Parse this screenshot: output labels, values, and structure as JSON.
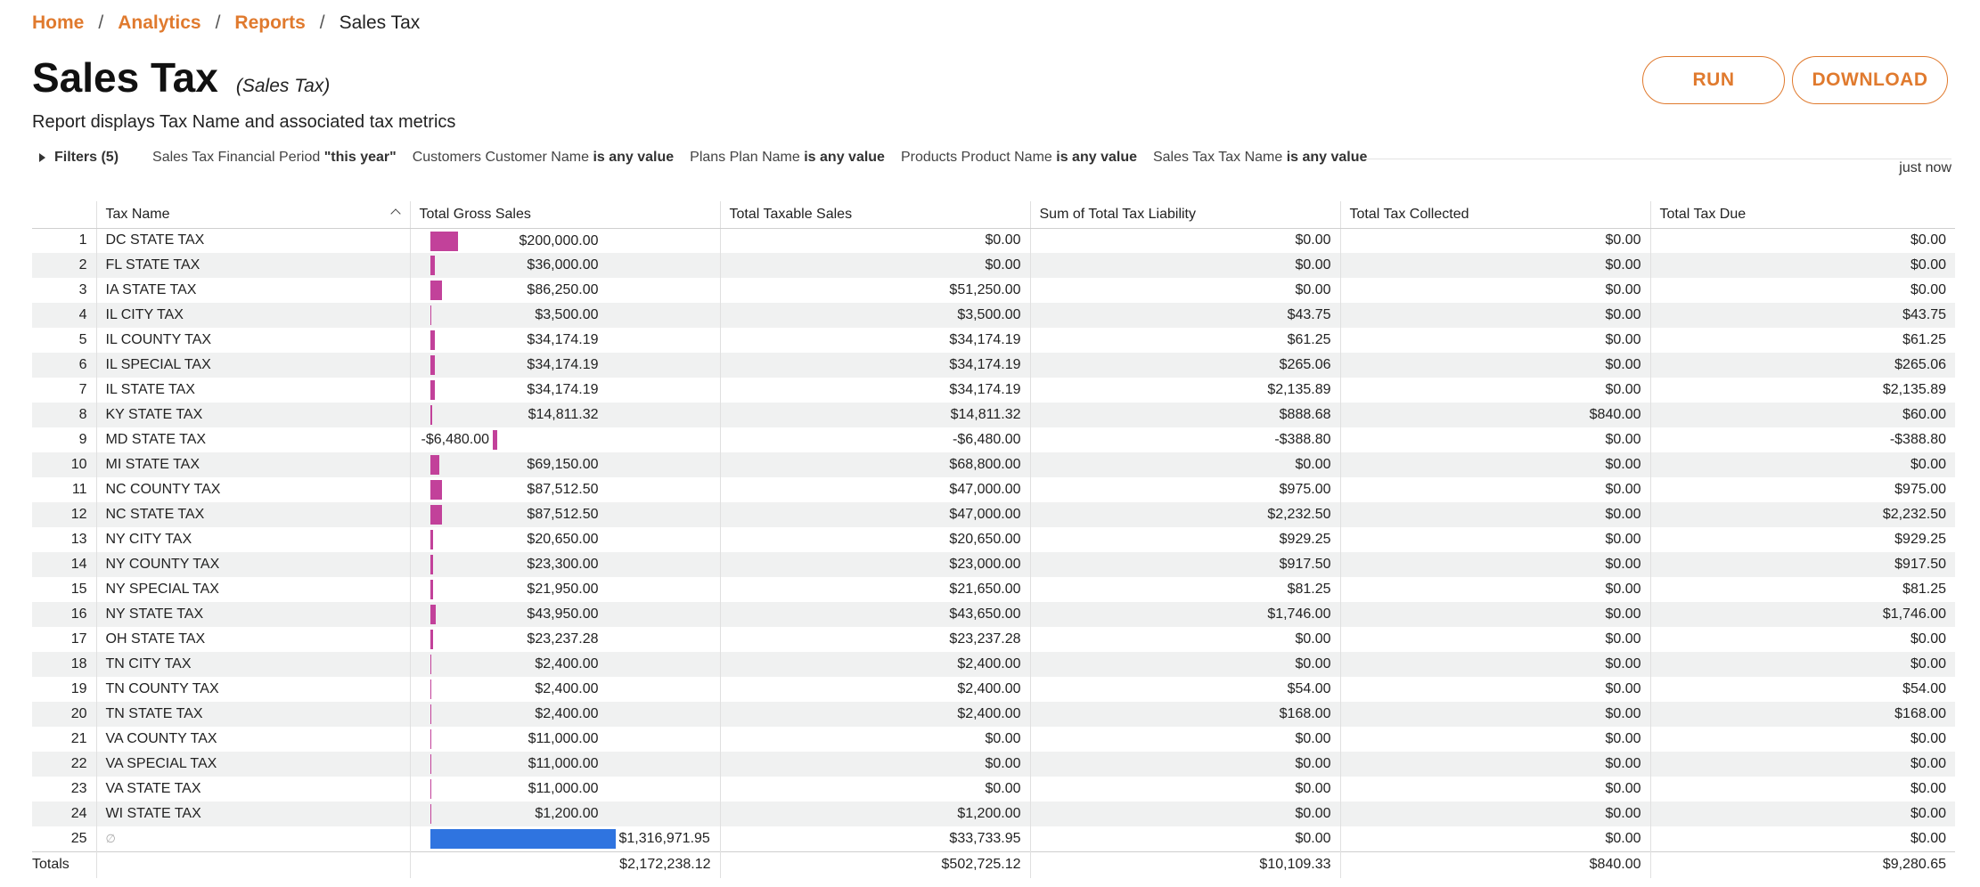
{
  "breadcrumb": {
    "home": "Home",
    "analytics": "Analytics",
    "reports": "Reports",
    "current": "Sales Tax",
    "separator": "/"
  },
  "header": {
    "title": "Sales Tax",
    "subtitle": "(Sales Tax)",
    "description": "Report displays Tax Name and associated tax metrics"
  },
  "actions": {
    "run": "RUN",
    "download": "DOWNLOAD"
  },
  "filters": {
    "toggle": "Filters (5)",
    "items": [
      {
        "label": "Sales Tax Financial Period",
        "value": "\"this year\""
      },
      {
        "label": "Customers Customer Name",
        "value": "is any value"
      },
      {
        "label": "Plans Plan Name",
        "value": "is any value"
      },
      {
        "label": "Products Product Name",
        "value": "is any value"
      },
      {
        "label": "Sales Tax Tax Name",
        "value": "is any value"
      }
    ]
  },
  "timestamp": "just now",
  "table": {
    "columns": [
      "",
      "Tax Name",
      "Total Gross Sales",
      "Total Taxable Sales",
      "Sum of Total Tax Liability",
      "Total Tax Collected",
      "Total Tax Due"
    ],
    "rows": [
      {
        "n": "1",
        "name": "DC STATE TAX",
        "gross": "$200,000.00",
        "gross_value": 200000,
        "taxable": "$0.00",
        "liability": "$0.00",
        "collected": "$0.00",
        "due": "$0.00"
      },
      {
        "n": "2",
        "name": "FL STATE TAX",
        "gross": "$36,000.00",
        "gross_value": 36000,
        "taxable": "$0.00",
        "liability": "$0.00",
        "collected": "$0.00",
        "due": "$0.00"
      },
      {
        "n": "3",
        "name": "IA STATE TAX",
        "gross": "$86,250.00",
        "gross_value": 86250,
        "taxable": "$51,250.00",
        "liability": "$0.00",
        "collected": "$0.00",
        "due": "$0.00"
      },
      {
        "n": "4",
        "name": "IL CITY TAX",
        "gross": "$3,500.00",
        "gross_value": 3500,
        "taxable": "$3,500.00",
        "liability": "$43.75",
        "collected": "$0.00",
        "due": "$43.75"
      },
      {
        "n": "5",
        "name": "IL COUNTY TAX",
        "gross": "$34,174.19",
        "gross_value": 34174.19,
        "taxable": "$34,174.19",
        "liability": "$61.25",
        "collected": "$0.00",
        "due": "$61.25"
      },
      {
        "n": "6",
        "name": "IL SPECIAL TAX",
        "gross": "$34,174.19",
        "gross_value": 34174.19,
        "taxable": "$34,174.19",
        "liability": "$265.06",
        "collected": "$0.00",
        "due": "$265.06"
      },
      {
        "n": "7",
        "name": "IL STATE TAX",
        "gross": "$34,174.19",
        "gross_value": 34174.19,
        "taxable": "$34,174.19",
        "liability": "$2,135.89",
        "collected": "$0.00",
        "due": "$2,135.89"
      },
      {
        "n": "8",
        "name": "KY STATE TAX",
        "gross": "$14,811.32",
        "gross_value": 14811.32,
        "taxable": "$14,811.32",
        "liability": "$888.68",
        "collected": "$840.00",
        "due": "$60.00"
      },
      {
        "n": "9",
        "name": "MD STATE TAX",
        "gross": "-$6,480.00",
        "gross_value": -6480,
        "taxable": "-$6,480.00",
        "liability": "-$388.80",
        "collected": "$0.00",
        "due": "-$388.80"
      },
      {
        "n": "10",
        "name": "MI STATE TAX",
        "gross": "$69,150.00",
        "gross_value": 69150,
        "taxable": "$68,800.00",
        "liability": "$0.00",
        "collected": "$0.00",
        "due": "$0.00"
      },
      {
        "n": "11",
        "name": "NC COUNTY TAX",
        "gross": "$87,512.50",
        "gross_value": 87512.5,
        "taxable": "$47,000.00",
        "liability": "$975.00",
        "collected": "$0.00",
        "due": "$975.00"
      },
      {
        "n": "12",
        "name": "NC STATE TAX",
        "gross": "$87,512.50",
        "gross_value": 87512.5,
        "taxable": "$47,000.00",
        "liability": "$2,232.50",
        "collected": "$0.00",
        "due": "$2,232.50"
      },
      {
        "n": "13",
        "name": "NY CITY TAX",
        "gross": "$20,650.00",
        "gross_value": 20650,
        "taxable": "$20,650.00",
        "liability": "$929.25",
        "collected": "$0.00",
        "due": "$929.25"
      },
      {
        "n": "14",
        "name": "NY COUNTY TAX",
        "gross": "$23,300.00",
        "gross_value": 23300,
        "taxable": "$23,000.00",
        "liability": "$917.50",
        "collected": "$0.00",
        "due": "$917.50"
      },
      {
        "n": "15",
        "name": "NY SPECIAL TAX",
        "gross": "$21,950.00",
        "gross_value": 21950,
        "taxable": "$21,650.00",
        "liability": "$81.25",
        "collected": "$0.00",
        "due": "$81.25"
      },
      {
        "n": "16",
        "name": "NY STATE TAX",
        "gross": "$43,950.00",
        "gross_value": 43950,
        "taxable": "$43,650.00",
        "liability": "$1,746.00",
        "collected": "$0.00",
        "due": "$1,746.00"
      },
      {
        "n": "17",
        "name": "OH STATE TAX",
        "gross": "$23,237.28",
        "gross_value": 23237.28,
        "taxable": "$23,237.28",
        "liability": "$0.00",
        "collected": "$0.00",
        "due": "$0.00"
      },
      {
        "n": "18",
        "name": "TN CITY TAX",
        "gross": "$2,400.00",
        "gross_value": 2400,
        "taxable": "$2,400.00",
        "liability": "$0.00",
        "collected": "$0.00",
        "due": "$0.00"
      },
      {
        "n": "19",
        "name": "TN COUNTY TAX",
        "gross": "$2,400.00",
        "gross_value": 2400,
        "taxable": "$2,400.00",
        "liability": "$54.00",
        "collected": "$0.00",
        "due": "$54.00"
      },
      {
        "n": "20",
        "name": "TN STATE TAX",
        "gross": "$2,400.00",
        "gross_value": 2400,
        "taxable": "$2,400.00",
        "liability": "$168.00",
        "collected": "$0.00",
        "due": "$168.00"
      },
      {
        "n": "21",
        "name": "VA COUNTY TAX",
        "gross": "$11,000.00",
        "gross_value": 11000,
        "taxable": "$0.00",
        "liability": "$0.00",
        "collected": "$0.00",
        "due": "$0.00"
      },
      {
        "n": "22",
        "name": "VA SPECIAL TAX",
        "gross": "$11,000.00",
        "gross_value": 11000,
        "taxable": "$0.00",
        "liability": "$0.00",
        "collected": "$0.00",
        "due": "$0.00"
      },
      {
        "n": "23",
        "name": "VA STATE TAX",
        "gross": "$11,000.00",
        "gross_value": 11000,
        "taxable": "$0.00",
        "liability": "$0.00",
        "collected": "$0.00",
        "due": "$0.00"
      },
      {
        "n": "24",
        "name": "WI STATE TAX",
        "gross": "$1,200.00",
        "gross_value": 1200,
        "taxable": "$1,200.00",
        "liability": "$0.00",
        "collected": "$0.00",
        "due": "$0.00"
      },
      {
        "n": "25",
        "name": "∅",
        "is_null": true,
        "gross": "$1,316,971.95",
        "gross_value": 1316971.95,
        "taxable": "$33,733.95",
        "liability": "$0.00",
        "collected": "$0.00",
        "due": "$0.00"
      }
    ],
    "totals": {
      "label": "Totals",
      "gross": "$2,172,238.12",
      "taxable": "$502,725.12",
      "liability": "$10,109.33",
      "collected": "$840.00",
      "due": "$9,280.65"
    }
  },
  "colors": {
    "accent": "#e07a2e",
    "bar": "#c2419a",
    "bar_null": "#2f74e0"
  }
}
